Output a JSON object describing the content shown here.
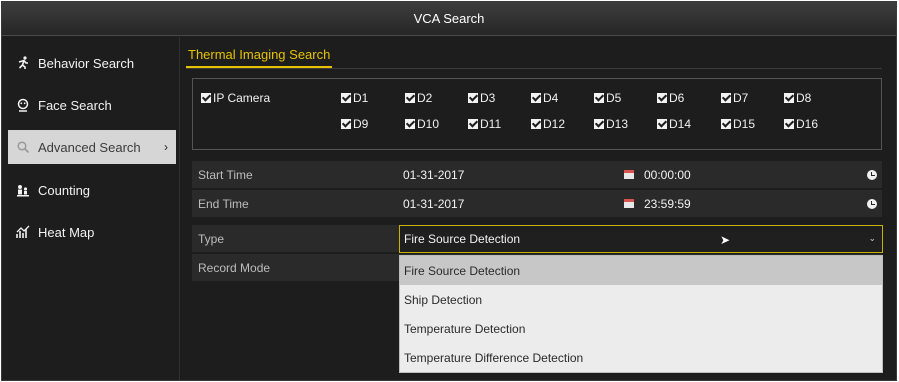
{
  "window": {
    "title": "VCA Search"
  },
  "sidebar": {
    "items": [
      {
        "label": "Behavior Search",
        "icon": "running-person-icon"
      },
      {
        "label": "Face Search",
        "icon": "face-icon"
      },
      {
        "label": "Advanced Search",
        "icon": "magnifier-icon",
        "active": true
      },
      {
        "label": "Counting",
        "icon": "people-count-icon"
      },
      {
        "label": "Heat Map",
        "icon": "heat-map-icon"
      }
    ],
    "active_chevron": "›"
  },
  "tab": {
    "label": "Thermal Imaging Search"
  },
  "cameras": {
    "group_label": "IP Camera",
    "channels": [
      "D1",
      "D2",
      "D3",
      "D4",
      "D5",
      "D6",
      "D7",
      "D8",
      "D9",
      "D10",
      "D11",
      "D12",
      "D13",
      "D14",
      "D15",
      "D16"
    ],
    "all_checked": true
  },
  "form": {
    "start_time": {
      "label": "Start Time",
      "date": "01-31-2017",
      "time": "00:00:00"
    },
    "end_time": {
      "label": "End Time",
      "date": "01-31-2017",
      "time": "23:59:59"
    },
    "type": {
      "label": "Type",
      "value": "Fire Source Detection",
      "arrow": "⌄"
    },
    "record_mode": {
      "label": "Record Mode"
    }
  },
  "dropdown": {
    "options": [
      "Fire Source Detection",
      "Ship Detection",
      "Temperature Detection",
      "Temperature Difference Detection"
    ],
    "selected_index": 0
  },
  "colors": {
    "accent": "#e6c200",
    "select_border": "#c8b400",
    "calendar_red": "#d9534f"
  }
}
